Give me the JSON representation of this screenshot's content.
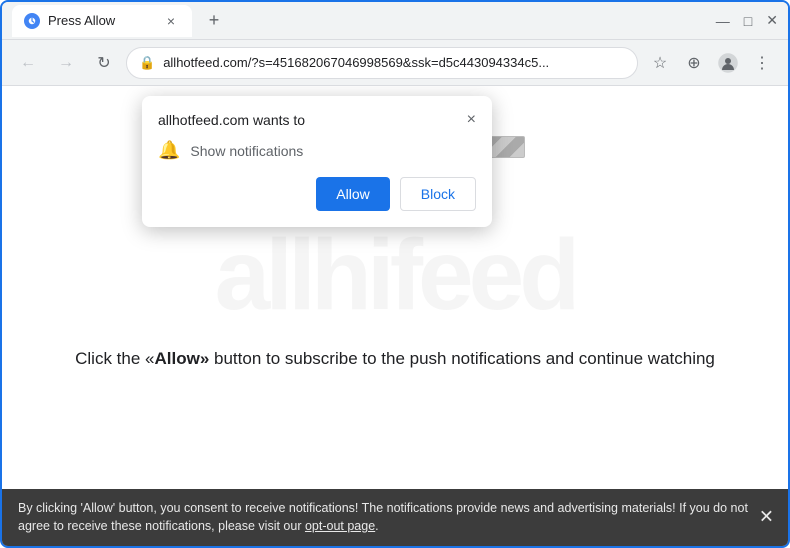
{
  "browser": {
    "tab_title": "Press Allow",
    "tab_close_label": "×",
    "new_tab_label": "+",
    "window_minimize": "—",
    "window_maximize": "□",
    "window_close": "✕",
    "address": "allhotfeed.com/?s=451682067046998569&ssk=d5c443094334c5...",
    "back_icon": "←",
    "forward_icon": "→",
    "reload_icon": "↻",
    "lock_icon": "🔒",
    "star_icon": "☆",
    "profile_icon": "👤",
    "menu_icon": "⋮",
    "download_icon": "⊕"
  },
  "notification_dialog": {
    "title": "allhotfeed.com wants to",
    "close_label": "×",
    "feature_label": "Show notifications",
    "bell_icon": "🔔",
    "allow_label": "Allow",
    "block_label": "Block"
  },
  "page": {
    "watermark": "allhifeed",
    "main_text_prefix": "Click the «",
    "main_text_highlight": "Allow»",
    "main_text_suffix": " button to subscribe to the push notifications and continue watching"
  },
  "bottom_bar": {
    "text": "By clicking 'Allow' button, you consent to receive notifications! The notifications provide news and advertising materials! If you do not agree to receive these notifications, please visit our ",
    "link_text": "opt-out page",
    "text_end": ".",
    "close_label": "✕"
  }
}
